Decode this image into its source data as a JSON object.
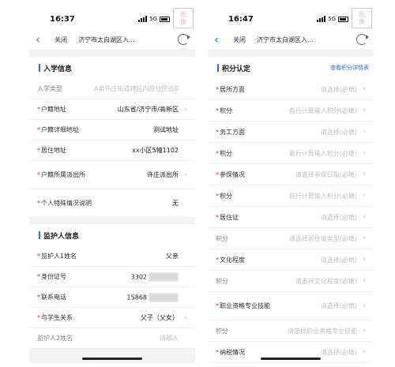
{
  "left": {
    "status": {
      "time": "16:37",
      "network": "5G"
    },
    "nav": {
      "back": "‹",
      "close": "关闭",
      "title": "济宁市太白湖区入..."
    },
    "enroll": {
      "title": "入学信息",
      "rows": [
        {
          "label": "入学类型",
          "value": "A类许庄街道辖区内原住民适龄",
          "required": false,
          "placeholder": true,
          "chevron": false
        },
        {
          "label": "户籍地址",
          "value": "山东省/济宁市/高新区",
          "required": true,
          "placeholder": false,
          "chevron": true
        },
        {
          "label": "户籍详细地址",
          "value": "测试地址",
          "required": true,
          "placeholder": false,
          "chevron": false
        },
        {
          "label": "居住地址",
          "value": "xx小区5幢1102",
          "required": true,
          "placeholder": false,
          "chevron": false
        },
        {
          "label": "户籍所属派出所",
          "value": "许庄派出所",
          "required": true,
          "placeholder": false,
          "chevron": true
        },
        {
          "label": "个人特殊情况说明",
          "value": "无",
          "required": true,
          "placeholder": false,
          "chevron": false
        }
      ]
    },
    "guardian": {
      "title": "监护人信息",
      "rows": [
        {
          "label": "监护人1姓名",
          "value": "父亲",
          "required": true,
          "placeholder": false,
          "chevron": false,
          "blurred": false
        },
        {
          "label": "身份证号",
          "value": "3302",
          "required": true,
          "placeholder": false,
          "chevron": false,
          "blurred": true
        },
        {
          "label": "联系电话",
          "value": "15868",
          "required": true,
          "placeholder": false,
          "chevron": false,
          "blurred": true
        },
        {
          "label": "与学生关系",
          "value": "父子（父女）",
          "required": true,
          "placeholder": false,
          "chevron": true,
          "blurred": false
        },
        {
          "label": "监护人2姓名",
          "value": "请输入",
          "required": false,
          "placeholder": true,
          "chevron": false,
          "blurred": false
        }
      ]
    }
  },
  "right": {
    "status": {
      "time": "16:47",
      "network": "5G"
    },
    "nav": {
      "back": "‹",
      "close": "关闭",
      "title": "济宁市太白湖区入..."
    },
    "points": {
      "title": "积分认定",
      "link": "查看积分详情表",
      "rows": [
        {
          "label": "居所方面",
          "value": "请选择(必填)",
          "required": true,
          "chevron": true
        },
        {
          "label": "积分",
          "value": "自行计算输入积分(必填)",
          "required": true,
          "chevron": true
        },
        {
          "label": "务工方面",
          "value": "请选择(必填)",
          "required": true,
          "chevron": true
        },
        {
          "label": "积分",
          "value": "自行计算输入积分(必填)",
          "required": true,
          "chevron": true
        },
        {
          "label": "参保情况",
          "value": "请选择参保日期(必填)",
          "required": true,
          "chevron": true
        },
        {
          "label": "积分",
          "value": "自行计算输入积分(必填)",
          "required": true,
          "chevron": true
        },
        {
          "label": "居住证",
          "value": "请选择(必填)",
          "required": true,
          "chevron": true
        },
        {
          "label": "积分",
          "value": "请选择居住证类型(必填)",
          "required": false,
          "chevron": true
        },
        {
          "label": "文化程度",
          "value": "请选择(必填)",
          "required": true,
          "chevron": true
        },
        {
          "label": "积分",
          "value": "请选择文化程度(必填)",
          "required": false,
          "chevron": true
        },
        {
          "label": "职业资格专业技能",
          "value": "请选择(必填)",
          "required": true,
          "chevron": true
        },
        {
          "label": "积分",
          "value": "请选择职业资格专业技能",
          "required": false,
          "chevron": true
        },
        {
          "label": "纳税情况",
          "value": "请选择(必填)",
          "required": true,
          "chevron": true
        }
      ]
    }
  },
  "stamp_text": "图\n像"
}
